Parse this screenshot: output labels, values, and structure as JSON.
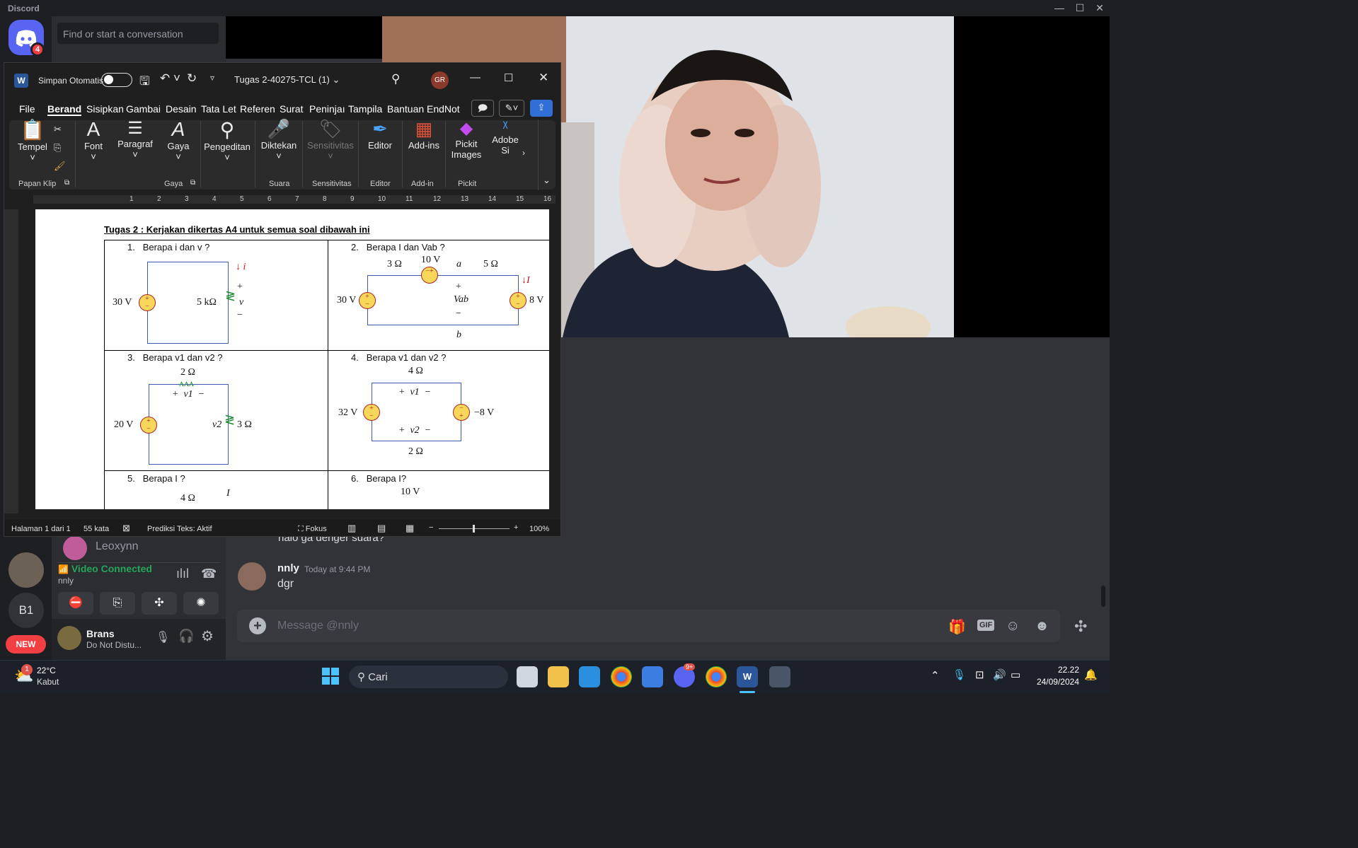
{
  "discord": {
    "app_title": "Discord",
    "home_badge": "4",
    "search_placeholder": "Find or start a conversation",
    "server_initials": "B1",
    "new_badge": "NEW",
    "dm_list_item": "Leoxynn",
    "voice": {
      "status": "Video Connected",
      "user": "nnly"
    },
    "user_panel": {
      "name": "Brans",
      "status": "Do Not Distu..."
    },
    "messages": [
      {
        "partial_text": "halo ga denger suara?"
      },
      {
        "author": "nnly",
        "timestamp": "Today at 9:44 PM",
        "text": "dgr"
      }
    ],
    "message_placeholder": "Message @nnly",
    "composer_gif": "GIF"
  },
  "word": {
    "autosave_label": "Simpan Otomatis",
    "doc_title": "Tugas 2-40275-TCL (1)",
    "avatar_initials": "GR",
    "tabs": [
      "File",
      "Beranda",
      "Sisipkan",
      "Gambar",
      "Desain",
      "Tata Letak",
      "Referensi",
      "Surat",
      "Peninjauan",
      "Tampilan",
      "Bantuan",
      "EndNote"
    ],
    "tab_display": [
      "File",
      "Berand",
      "Sisipkan",
      "Gambai",
      "Desain",
      "Tata Let",
      "Referen",
      "Surat",
      "Peninjaı",
      "Tampila",
      "Bantuan",
      "EndNot"
    ],
    "ribbon": {
      "paste": "Tempel",
      "font": "Font",
      "paragraph": "Paragraf",
      "styles": "Gaya",
      "editing": "Pengeditan",
      "dictate": "Diktekan",
      "sensitivity": "Sensitivitas",
      "editor": "Editor",
      "addins": "Add-ins",
      "pickit": "Pickit Images",
      "adobe": "Adobe Si",
      "groups": [
        "Papan Klip",
        "Gaya",
        "Suara",
        "Sensitivitas",
        "Editor",
        "Add-in",
        "Pickit"
      ]
    },
    "ruler_ticks": [
      "1",
      "2",
      "3",
      "4",
      "5",
      "6",
      "7",
      "8",
      "9",
      "10",
      "11",
      "12",
      "13",
      "14",
      "15",
      "16"
    ],
    "document": {
      "heading": "Tugas 2 : Kerjakan dikertas A4 untuk semua soal dibawah ini",
      "questions": [
        {
          "num": "1.",
          "text": "Berapa i dan v ?"
        },
        {
          "num": "2.",
          "text": "Berapa I dan Vab ?"
        },
        {
          "num": "3.",
          "text": "Berapa v1 dan v2 ?"
        },
        {
          "num": "4.",
          "text": "Berapa v1 dan v2 ?"
        },
        {
          "num": "5.",
          "text": "Berapa I ?"
        },
        {
          "num": "6.",
          "text": "Berapa I?"
        }
      ],
      "circuit1": {
        "source": "30 V",
        "resistor": "5 kΩ",
        "current": "i",
        "voltage": "v"
      },
      "circuit2": {
        "r1": "3 Ω",
        "src_mid": "10 V",
        "node_a": "a",
        "r2": "5 Ω",
        "src_left": "30 V",
        "vab": "Vab",
        "src_right": "8 V",
        "current": "I",
        "node_b": "b"
      },
      "circuit3": {
        "r_top": "2 Ω",
        "v1": "v1",
        "src": "20 V",
        "v2": "v2",
        "r_right": "3 Ω"
      },
      "circuit4": {
        "r_top": "4 Ω",
        "v1": "v1",
        "src_left": "32 V",
        "src_right": "−8 V",
        "v2": "v2",
        "r_bottom": "2 Ω"
      },
      "circuit5": {
        "r": "4 Ω",
        "current": "I"
      },
      "circuit6": {
        "src": "10 V"
      }
    },
    "status": {
      "page": "Halaman 1 dari 1",
      "words": "55 kata",
      "prediction": "Prediksi Teks: Aktif",
      "focus": "Fokus",
      "zoom": "100%"
    }
  },
  "taskbar": {
    "weather_temp": "22°C",
    "weather_desc": "Kabut",
    "weather_badge": "1",
    "search": "Cari",
    "discord_badge": "9+",
    "time": "22.22",
    "date": "24/09/2024"
  }
}
